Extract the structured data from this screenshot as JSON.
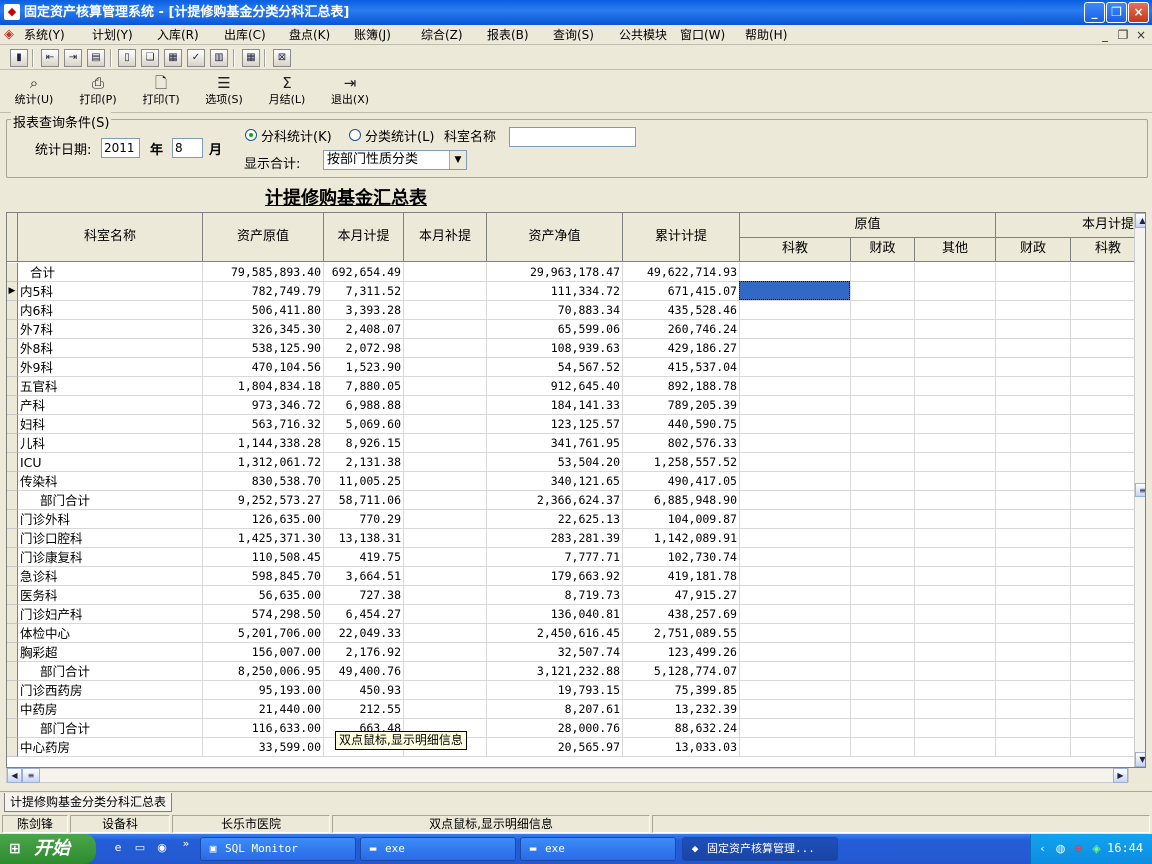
{
  "window": {
    "title": "固定资产核算管理系统 - [计提修购基金分类分科汇总表]"
  },
  "menu": [
    "系统(Y)",
    "计划(Y)",
    "入库(R)",
    "出库(C)",
    "盘点(K)",
    "账簿(J)",
    "综合(Z)",
    "报表(B)",
    "查询(S)",
    "公共模块",
    "窗口(W)",
    "帮助(H)"
  ],
  "mdi": {
    "min": "_",
    "restore": "❐",
    "close": "×"
  },
  "toolbar2": [
    {
      "label": "统计(U)",
      "icon": "binoculars-icon",
      "glyph": "⌕"
    },
    {
      "label": "打印(P)",
      "icon": "printer-icon",
      "glyph": "⎙"
    },
    {
      "label": "打印(T)",
      "icon": "print-preview-icon",
      "glyph": "🗋"
    },
    {
      "label": "选项(S)",
      "icon": "options-icon",
      "glyph": "☰"
    },
    {
      "label": "月结(L)",
      "icon": "sum-icon",
      "glyph": "Σ"
    },
    {
      "label": "退出(X)",
      "icon": "exit-icon",
      "glyph": "⇥"
    }
  ],
  "query": {
    "legend": "报表查询条件(S)",
    "date_label": "统计日期:",
    "year": "2011",
    "year_label": "年",
    "month": "8",
    "month_label": "月",
    "radio1": "分科统计(K)",
    "radio2": "分类统计(L)",
    "dept_label": "科室名称",
    "dept_value": "",
    "show_label": "显示合计:",
    "show_value": "按部门性质分类"
  },
  "report_title": "计提修购基金汇总表",
  "table": {
    "headers": {
      "name": "科室名称",
      "orig": "资产原值",
      "month_accrual": "本月计提",
      "month_supp": "本月补提",
      "net": "资产净值",
      "cumulative": "累计计提",
      "group1": "原值",
      "group2": "本月计提",
      "g1_sub": [
        "科教",
        "财政",
        "其他"
      ],
      "g2_sub": [
        "财政",
        "科教"
      ]
    },
    "rows": [
      {
        "name": "合计",
        "indent": 1,
        "v1": "79,585,893.40",
        "v2": "692,654.49",
        "v3": "",
        "v4": "29,963,178.47",
        "v5": "49,622,714.93"
      },
      {
        "name": "内5科",
        "indent": 0,
        "v1": "782,749.79",
        "v2": "7,311.52",
        "v3": "",
        "v4": "111,334.72",
        "v5": "671,415.07"
      },
      {
        "name": "内6科",
        "indent": 0,
        "v1": "506,411.80",
        "v2": "3,393.28",
        "v3": "",
        "v4": "70,883.34",
        "v5": "435,528.46"
      },
      {
        "name": "外7科",
        "indent": 0,
        "v1": "326,345.30",
        "v2": "2,408.07",
        "v3": "",
        "v4": "65,599.06",
        "v5": "260,746.24"
      },
      {
        "name": "外8科",
        "indent": 0,
        "v1": "538,125.90",
        "v2": "2,072.98",
        "v3": "",
        "v4": "108,939.63",
        "v5": "429,186.27"
      },
      {
        "name": "外9科",
        "indent": 0,
        "v1": "470,104.56",
        "v2": "1,523.90",
        "v3": "",
        "v4": "54,567.52",
        "v5": "415,537.04"
      },
      {
        "name": "五官科",
        "indent": 0,
        "v1": "1,804,834.18",
        "v2": "7,880.05",
        "v3": "",
        "v4": "912,645.40",
        "v5": "892,188.78"
      },
      {
        "name": "产科",
        "indent": 0,
        "v1": "973,346.72",
        "v2": "6,988.88",
        "v3": "",
        "v4": "184,141.33",
        "v5": "789,205.39"
      },
      {
        "name": "妇科",
        "indent": 0,
        "v1": "563,716.32",
        "v2": "5,069.60",
        "v3": "",
        "v4": "123,125.57",
        "v5": "440,590.75"
      },
      {
        "name": "儿科",
        "indent": 0,
        "v1": "1,144,338.28",
        "v2": "8,926.15",
        "v3": "",
        "v4": "341,761.95",
        "v5": "802,576.33"
      },
      {
        "name": "ICU",
        "indent": 0,
        "v1": "1,312,061.72",
        "v2": "2,131.38",
        "v3": "",
        "v4": "53,504.20",
        "v5": "1,258,557.52"
      },
      {
        "name": "传染科",
        "indent": 0,
        "v1": "830,538.70",
        "v2": "11,005.25",
        "v3": "",
        "v4": "340,121.65",
        "v5": "490,417.05"
      },
      {
        "name": "部门合计",
        "indent": 2,
        "v1": "9,252,573.27",
        "v2": "58,711.06",
        "v3": "",
        "v4": "2,366,624.37",
        "v5": "6,885,948.90"
      },
      {
        "name": "门诊外科",
        "indent": 0,
        "v1": "126,635.00",
        "v2": "770.29",
        "v3": "",
        "v4": "22,625.13",
        "v5": "104,009.87"
      },
      {
        "name": "门诊口腔科",
        "indent": 0,
        "v1": "1,425,371.30",
        "v2": "13,138.31",
        "v3": "",
        "v4": "283,281.39",
        "v5": "1,142,089.91"
      },
      {
        "name": "门诊康复科",
        "indent": 0,
        "v1": "110,508.45",
        "v2": "419.75",
        "v3": "",
        "v4": "7,777.71",
        "v5": "102,730.74"
      },
      {
        "name": "急诊科",
        "indent": 0,
        "v1": "598,845.70",
        "v2": "3,664.51",
        "v3": "",
        "v4": "179,663.92",
        "v5": "419,181.78"
      },
      {
        "name": "医务科",
        "indent": 0,
        "v1": "56,635.00",
        "v2": "727.38",
        "v3": "",
        "v4": "8,719.73",
        "v5": "47,915.27"
      },
      {
        "name": "门诊妇产科",
        "indent": 0,
        "v1": "574,298.50",
        "v2": "6,454.27",
        "v3": "",
        "v4": "136,040.81",
        "v5": "438,257.69"
      },
      {
        "name": "体检中心",
        "indent": 0,
        "v1": "5,201,706.00",
        "v2": "22,049.33",
        "v3": "",
        "v4": "2,450,616.45",
        "v5": "2,751,089.55"
      },
      {
        "name": "胸彩超",
        "indent": 0,
        "v1": "156,007.00",
        "v2": "2,176.92",
        "v3": "",
        "v4": "32,507.74",
        "v5": "123,499.26"
      },
      {
        "name": "部门合计",
        "indent": 2,
        "v1": "8,250,006.95",
        "v2": "49,400.76",
        "v3": "",
        "v4": "3,121,232.88",
        "v5": "5,128,774.07"
      },
      {
        "name": "门诊西药房",
        "indent": 0,
        "v1": "95,193.00",
        "v2": "450.93",
        "v3": "",
        "v4": "19,793.15",
        "v5": "75,399.85"
      },
      {
        "name": "中药房",
        "indent": 0,
        "v1": "21,440.00",
        "v2": "212.55",
        "v3": "",
        "v4": "8,207.61",
        "v5": "13,232.39"
      },
      {
        "name": "部门合计",
        "indent": 2,
        "v1": "116,633.00",
        "v2": "663.48",
        "v3": "",
        "v4": "28,000.76",
        "v5": "88,632.24"
      },
      {
        "name": "中心药房",
        "indent": 0,
        "v1": "33,599.00",
        "v2": "",
        "v3": "",
        "v4": "20,565.97",
        "v5": "13,033.03"
      }
    ]
  },
  "tooltip": "双点鼠标,显示明细信息",
  "tab": "计提修购基金分类分科汇总表",
  "status": [
    "陈剑锋",
    "设备科",
    "长乐市医院",
    "双点鼠标,显示明细信息"
  ],
  "taskbar": {
    "start": "开始",
    "tasks": [
      "SQL Monitor",
      "exe",
      "exe",
      "固定资产核算管理..."
    ],
    "clock": "16:44"
  }
}
